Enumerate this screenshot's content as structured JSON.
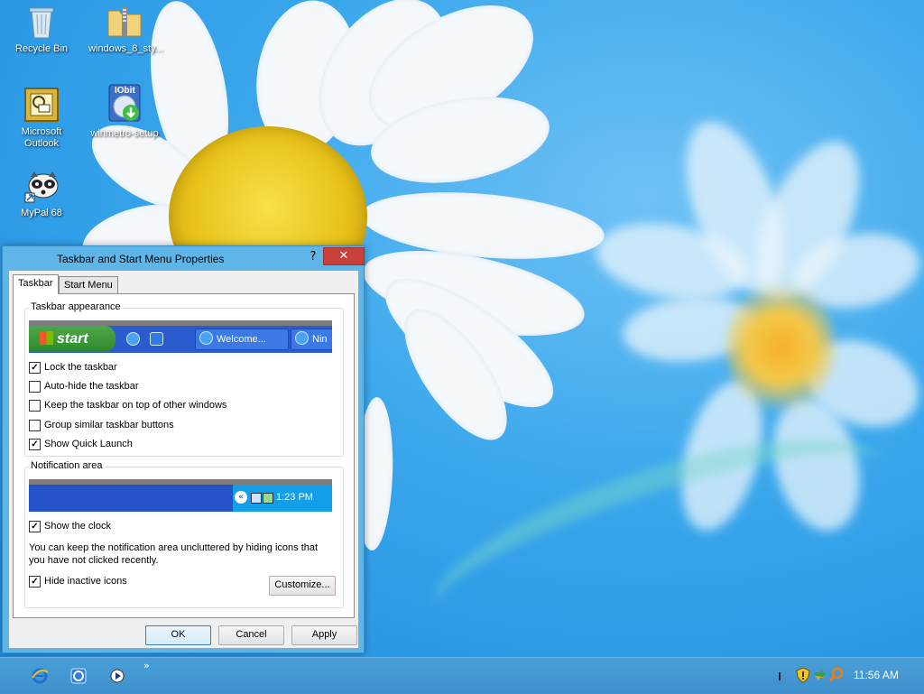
{
  "desktop": {
    "icons": [
      {
        "label": "Recycle Bin"
      },
      {
        "label": "windows_8_sty..."
      },
      {
        "label": "Microsoft Outlook"
      },
      {
        "label": "winmetro-setup"
      },
      {
        "label": "MyPal 68"
      }
    ],
    "iobit_logo_text": "IObit"
  },
  "dialog": {
    "title": "Taskbar and Start Menu Properties",
    "help_label": "?",
    "close_label": "✕",
    "tabs": [
      {
        "label": "Taskbar",
        "active": true
      },
      {
        "label": "Start Menu",
        "active": false
      }
    ],
    "taskbar_appearance": {
      "label": "Taskbar appearance",
      "preview": {
        "start_label": "start",
        "buttons": [
          "Welcome...",
          "Nin"
        ]
      },
      "options": [
        {
          "label": "Lock the taskbar",
          "checked": true
        },
        {
          "label": "Auto-hide the taskbar",
          "checked": false
        },
        {
          "label": "Keep the taskbar on top of other windows",
          "checked": false
        },
        {
          "label": "Group similar taskbar buttons",
          "checked": false
        },
        {
          "label": "Show Quick Launch",
          "checked": true
        }
      ]
    },
    "notification_area": {
      "label": "Notification area",
      "preview_time": "1:23 PM",
      "show_clock": {
        "label": "Show the clock",
        "checked": true
      },
      "description": "You can keep the notification area uncluttered by hiding icons that you have not clicked recently.",
      "hide_inactive": {
        "label": "Hide inactive icons",
        "checked": true
      },
      "customize_label": "Customize..."
    },
    "buttons": {
      "ok": "OK",
      "cancel": "Cancel",
      "apply": "Apply"
    }
  },
  "taskbar": {
    "chevron": "»",
    "clock": "11:56 AM"
  }
}
